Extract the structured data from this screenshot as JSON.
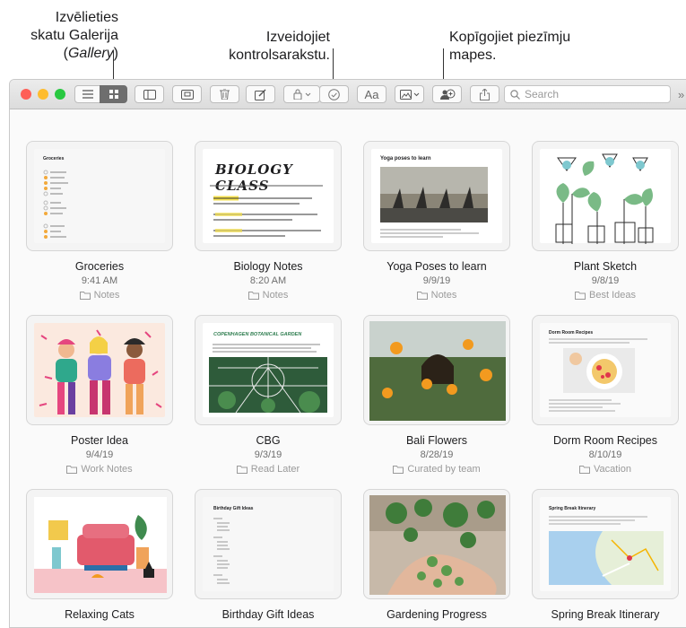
{
  "callouts": {
    "gallery_line1": "Izvēlieties",
    "gallery_line2": "skatu Galerija",
    "gallery_line3_open": "(",
    "gallery_line3_italic": "Gallery",
    "gallery_line3_close": ")",
    "checklist_line1": "Izveidojiet",
    "checklist_line2": "kontrolsarakstu.",
    "share_line1": "Kopīgojiet piezīmju",
    "share_line2": "mapes."
  },
  "toolbar": {
    "search_placeholder": "Search",
    "font_label": "Aa",
    "overflow": "»",
    "icons": [
      "list-view-icon",
      "gallery-view-icon",
      "sidebar-icon",
      "attachments-icon",
      "trash-icon",
      "compose-icon",
      "lock-icon",
      "checklist-icon",
      "format-icon",
      "media-icon",
      "collaborate-icon",
      "share-icon",
      "search-icon"
    ]
  },
  "notes": [
    {
      "title": "Groceries",
      "date": "9:41 AM",
      "folder": "Notes"
    },
    {
      "title": "Biology Notes",
      "date": "8:20 AM",
      "folder": "Notes"
    },
    {
      "title": "Yoga Poses to learn",
      "date": "9/9/19",
      "folder": "Notes"
    },
    {
      "title": "Plant Sketch",
      "date": "9/8/19",
      "folder": "Best Ideas"
    },
    {
      "title": "Poster Idea",
      "date": "9/4/19",
      "folder": "Work Notes"
    },
    {
      "title": "CBG",
      "date": "9/3/19",
      "folder": "Read Later"
    },
    {
      "title": "Bali Flowers",
      "date": "8/28/19",
      "folder": "Curated by team"
    },
    {
      "title": "Dorm Room Recipes",
      "date": "8/10/19",
      "folder": "Vacation"
    },
    {
      "title": "Relaxing Cats",
      "date": "",
      "folder": ""
    },
    {
      "title": "Birthday Gift Ideas",
      "date": "",
      "folder": ""
    },
    {
      "title": "Gardening Progress",
      "date": "",
      "folder": ""
    },
    {
      "title": "Spring Break Itinerary",
      "date": "",
      "folder": ""
    }
  ],
  "thumb_text": {
    "biology_heading": "BIOLOGY CLASS",
    "yoga_heading": "Yoga poses to learn",
    "cbg_heading": "COPENHAGEN BOTANICAL GARDEN",
    "groceries_heading": "Groceries",
    "birthday_heading": "Birthday Gift Ideas",
    "spring_heading": "Spring Break Itinerary",
    "dorm_heading": "Dorm Room Recipes"
  },
  "colors": {
    "close": "#fe5f57",
    "minimize": "#febc2e",
    "zoom": "#28c840",
    "folder": "#9a9a9a"
  }
}
